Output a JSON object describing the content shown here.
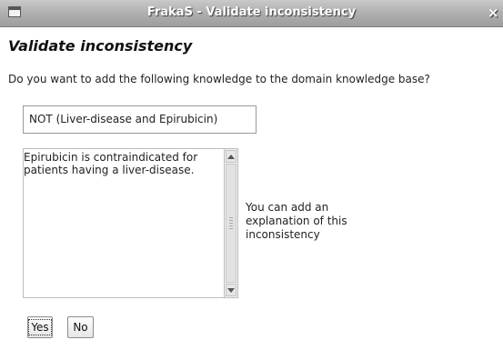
{
  "window": {
    "title": "FrakaS - Validate inconsistency",
    "close_glyph": "×"
  },
  "dialog": {
    "heading": "Validate inconsistency",
    "question": "Do you want to add the following knowledge to the domain knowledge base?",
    "knowledge": "NOT (Liver-disease and Epirubicin)",
    "explanation_lines": [
      "Epirubicin is contraindicated for",
      "patients having a liver-disease."
    ],
    "hint_lines": [
      "You can add an",
      "explanation of this",
      "inconsistency"
    ]
  },
  "buttons": {
    "yes_label": "Yes",
    "no_label": "No"
  },
  "icons": {
    "window_menu": "window-menu-icon",
    "close": "close-icon",
    "scroll_up": "arrow-up-icon",
    "scroll_down": "arrow-down-icon"
  }
}
